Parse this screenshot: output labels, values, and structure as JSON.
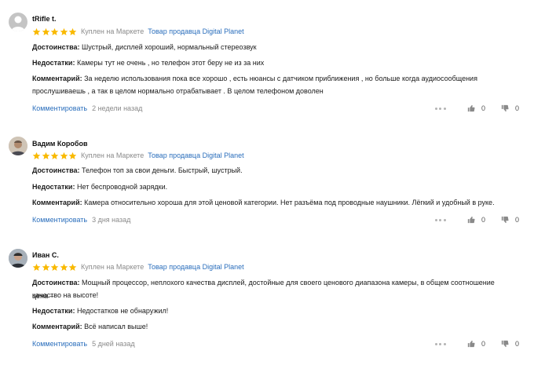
{
  "colors": {
    "star": "#f9b900",
    "link": "#2a6ebc",
    "muted": "#8a8a8a"
  },
  "reviews": [
    {
      "author": "tRifle t.",
      "rating": 5,
      "bought": "Куплен на Маркете",
      "seller": "Товар продавца Digital Planet",
      "pros_label": "Достоинства:",
      "pros": "Шустрый, дисплей хороший, нормальный стереозвук",
      "cons_label": "Недостатки:",
      "cons": "Камеры тут не очень , но телефон этот беру не из за них",
      "comment_label": "Комментарий:",
      "comment_line1": "За неделю использования пока все хорошо , есть нюансы с датчиком приближения , но больше когда аудиосообщения",
      "comment_line2": "прослушиваешь , а так в целом нормально отрабатывает . В целом телефоном доволен",
      "comment_link": "Комментировать",
      "time_ago": "2 недели назад",
      "likes": "0",
      "dislikes": "0"
    },
    {
      "author": "Вадим Коробов",
      "rating": 5,
      "bought": "Куплен на Маркете",
      "seller": "Товар продавца Digital Planet",
      "pros_label": "Достоинства:",
      "pros": "Телефон топ за свои деньги. Быстрый, шустрый.",
      "cons_label": "Недостатки:",
      "cons": "Нет беспроводной зарядки.",
      "comment_label": "Комментарий:",
      "comment_line1": "Камера относительно хороша для этой ценовой категории. Нет разъёма под проводные наушники. Лёгкий и удобный в руке.",
      "comment_link": "Комментировать",
      "time_ago": "3 дня назад",
      "likes": "0",
      "dislikes": "0"
    },
    {
      "author": "Иван С.",
      "rating": 5,
      "bought": "Куплен на Маркете",
      "seller": "Товар продавца Digital Planet",
      "pros_label": "Достоинства:",
      "pros_line1": "Мощный процессор, неплохого качества дисплей, достойные для своего ценового диапазона камеры, в общем соотношение цена –",
      "pros_line2": "качество на высоте!",
      "cons_label": "Недостатки:",
      "cons": "Недостатков не обнаружил!",
      "comment_label": "Комментарий:",
      "comment_line1": "Всё написал выше!",
      "comment_link": "Комментировать",
      "time_ago": "5 дней назад",
      "likes": "0",
      "dislikes": "0"
    }
  ]
}
